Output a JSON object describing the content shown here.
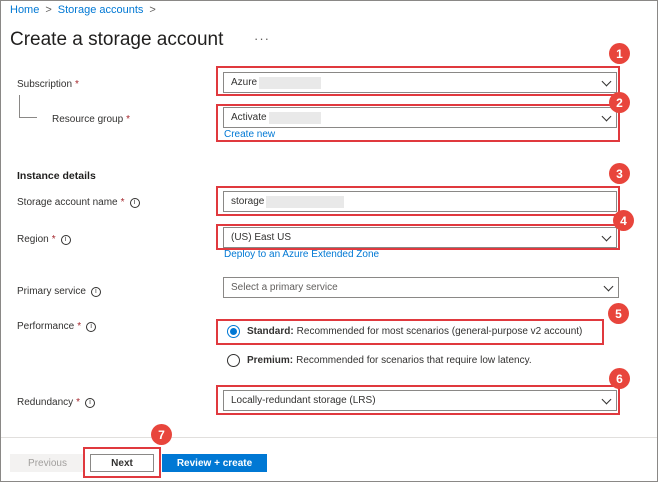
{
  "breadcrumb": {
    "home": "Home",
    "storage_accounts": "Storage accounts",
    "separator": ">"
  },
  "header": {
    "title": "Create a storage account",
    "more": "···"
  },
  "form": {
    "subscription": {
      "label": "Subscription",
      "required": "*",
      "value": "Azure"
    },
    "resource_group": {
      "label": "Resource group",
      "required": "*",
      "value": "Activate",
      "create_link": "Create new"
    },
    "instance_details": "Instance details",
    "storage_account_name": {
      "label": "Storage account name",
      "required": "*",
      "info": "i",
      "value": "storage"
    },
    "region": {
      "label": "Region",
      "required": "*",
      "info": "i",
      "value": "(US) East US",
      "extended_zone_link": "Deploy to an Azure Extended Zone"
    },
    "primary_service": {
      "label": "Primary service",
      "info": "i",
      "placeholder": "Select a primary service"
    },
    "performance": {
      "label": "Performance",
      "required": "*",
      "info": "i",
      "options": [
        {
          "name": "Standard:",
          "description": "Recommended for most scenarios (general-purpose v2 account)",
          "selected": true
        },
        {
          "name": "Premium:",
          "description": "Recommended for scenarios that require low latency.",
          "selected": false
        }
      ]
    },
    "redundancy": {
      "label": "Redundancy",
      "required": "*",
      "info": "i",
      "value": "Locally-redundant storage (LRS)"
    }
  },
  "footer": {
    "previous": "Previous",
    "next": "Next",
    "review_create": "Review + create"
  },
  "annotations": [
    "1",
    "2",
    "3",
    "4",
    "5",
    "6",
    "7"
  ],
  "colors": {
    "accent": "#0078d4",
    "highlight": "#e0393e",
    "badge": "#e8453c"
  }
}
